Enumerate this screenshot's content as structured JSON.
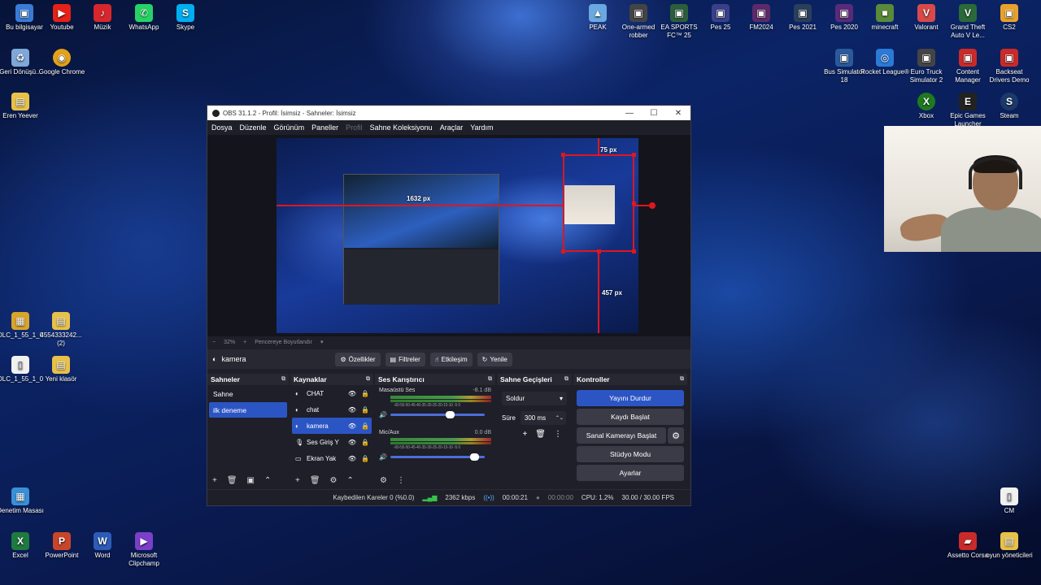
{
  "desktop": {
    "left_icons": [
      {
        "label": "Bu bilgisayar",
        "color": "#3a7bd5",
        "glyph": "▣"
      },
      {
        "label": "Youtube",
        "color": "#e62117",
        "glyph": "▶"
      },
      {
        "label": "Müzik",
        "color": "#d8262d",
        "glyph": "♪"
      },
      {
        "label": "WhatsApp",
        "color": "#25d366",
        "glyph": "✆"
      },
      {
        "label": "Skype",
        "color": "#00aff0",
        "glyph": "S"
      }
    ],
    "left_col": [
      {
        "label": "Geri Dönüşü...",
        "color": "#7fa7d8",
        "glyph": "♻"
      },
      {
        "label": "Google Chrome",
        "color": "#e3a21a",
        "glyph": "◉"
      },
      {
        "label": "Eren Yeever",
        "color": "#e8c14a",
        "glyph": "▤"
      },
      {
        "label": "DLC_1_55_1_0",
        "color": "#d8a42a",
        "glyph": "▦"
      },
      {
        "label": "4554333242... (2)",
        "color": "#e8c14a",
        "glyph": "▤"
      },
      {
        "label": "DLC_1_55_1_0",
        "color": "#f1f1f1",
        "glyph": "▯"
      },
      {
        "label": "Yeni klasör",
        "color": "#e8c14a",
        "glyph": "▤"
      },
      {
        "label": "Denetim Masası",
        "color": "#3a8fd8",
        "glyph": "▦"
      },
      {
        "label": "Excel",
        "color": "#1f7a3f",
        "glyph": "X"
      },
      {
        "label": "PowerPoint",
        "color": "#c9452a",
        "glyph": "P"
      },
      {
        "label": "Word",
        "color": "#2b5cb8",
        "glyph": "W"
      },
      {
        "label": "Microsoft Clipchamp",
        "color": "#7b3fc9",
        "glyph": "▶"
      }
    ],
    "right_icons": [
      {
        "label": "PEAK",
        "color": "#6aa8e0",
        "glyph": "▲"
      },
      {
        "label": "One-armed robber",
        "color": "#444",
        "glyph": "▣"
      },
      {
        "label": "EA SPORTS FC™ 25",
        "color": "#2c5e3c",
        "glyph": "▣"
      },
      {
        "label": "Pes 25",
        "color": "#3a3f8a",
        "glyph": "▣"
      },
      {
        "label": "FM2024",
        "color": "#5c2a6a",
        "glyph": "▣"
      },
      {
        "label": "Pes 2021",
        "color": "#2a3f5a",
        "glyph": "▣"
      },
      {
        "label": "Pes 2020",
        "color": "#5a2a7a",
        "glyph": "▣"
      },
      {
        "label": "minecraft",
        "color": "#5a8a3a",
        "glyph": "■"
      },
      {
        "label": "Valorant",
        "color": "#d84a4a",
        "glyph": "V"
      },
      {
        "label": "Grand Theft Auto V Le...",
        "color": "#2a6a3a",
        "glyph": "V"
      },
      {
        "label": "CS2",
        "color": "#e8a22a",
        "glyph": "▣"
      },
      {
        "label": "Bus Simulator 18",
        "color": "#2a5a9a",
        "glyph": "▣"
      },
      {
        "label": "Rocket League®",
        "color": "#2a7ad8",
        "glyph": "◎"
      },
      {
        "label": "Euro Truck Simulator 2",
        "color": "#444",
        "glyph": "▣"
      },
      {
        "label": "Content Manager",
        "color": "#c92a2a",
        "glyph": "▣"
      },
      {
        "label": "Backseat Drivers Demo",
        "color": "#c92a2a",
        "glyph": "▣"
      },
      {
        "label": "Xbox",
        "color": "#1f7a1f",
        "glyph": "X"
      },
      {
        "label": "Epic Games Launcher",
        "color": "#222",
        "glyph": "E"
      },
      {
        "label": "Steam",
        "color": "#1b3a6a",
        "glyph": "S"
      },
      {
        "label": "CM",
        "color": "#f1f1f1",
        "glyph": "▯"
      },
      {
        "label": "Assetto Corsa",
        "color": "#c92a2a",
        "glyph": "▰"
      },
      {
        "label": "oyun yöneticileri",
        "color": "#e8c14a",
        "glyph": "▤"
      }
    ]
  },
  "obs": {
    "title": "OBS 31.1.2 - Profil: İsimsiz - Sahneler: İsimsiz",
    "menu": [
      "Dosya",
      "Düzenle",
      "Görünüm",
      "Paneller",
      "Profil",
      "Sahne Koleksiyonu",
      "Araçlar",
      "Yardım"
    ],
    "preview": {
      "label_width": "1632 px",
      "label_top": "75 px",
      "label_bottom": "457 px"
    },
    "zoom": {
      "minus": "−",
      "value": "32%",
      "plus": "+",
      "fit": "Pencereye Boyutlandır"
    },
    "source_toolbar": {
      "source_name": "kamera",
      "properties": "Özellikler",
      "filters": "Filtreler",
      "interact": "Etkileşim",
      "refresh": "Yenile"
    },
    "scenes": {
      "title": "Sahneler",
      "items": [
        "Sahne",
        "ilk deneme"
      ],
      "selected": 1
    },
    "sources": {
      "title": "Kaynaklar",
      "items": [
        {
          "name": "CHAT",
          "icon": "◐"
        },
        {
          "name": "chat",
          "icon": "◐"
        },
        {
          "name": "kamera",
          "icon": "◐"
        },
        {
          "name": "Ses Giriş Y",
          "icon": "🎙"
        },
        {
          "name": "Ekran Yak",
          "icon": "▭"
        }
      ],
      "selected": 2
    },
    "mixer": {
      "title": "Ses Karıştırıcı",
      "channels": [
        {
          "name": "Masaüstü Ses",
          "db": "-8.1 dB",
          "volume": 0.8
        },
        {
          "name": "Mic/Aux",
          "db": "0.0 dB",
          "volume": 1.0
        }
      ],
      "ticks": "-60-55-50-45-40-35-30-25-20-15-10 -5 0"
    },
    "transitions": {
      "title": "Sahne Geçişleri",
      "selected": "Soldur",
      "duration_label": "Süre",
      "duration": "300 ms"
    },
    "controls": {
      "title": "Kontroller",
      "stop_stream": "Yayını Durdur",
      "start_recording": "Kaydı Başlat",
      "virtual_camera": "Sanal Kamerayı Başlat",
      "studio_mode": "Stüdyo Modu",
      "settings": "Ayarlar"
    },
    "status": {
      "dropped": "Kaybedilen Kareler 0 (%0.0)",
      "bitrate": "2362 kbps",
      "stream_time": "00:00:21",
      "rec_time": "00:00:00",
      "cpu": "CPU: 1.2%",
      "fps": "30.00 / 30.00 FPS"
    }
  },
  "colors": {
    "accent": "#2c55c4",
    "red_guides": "#e0161e"
  }
}
